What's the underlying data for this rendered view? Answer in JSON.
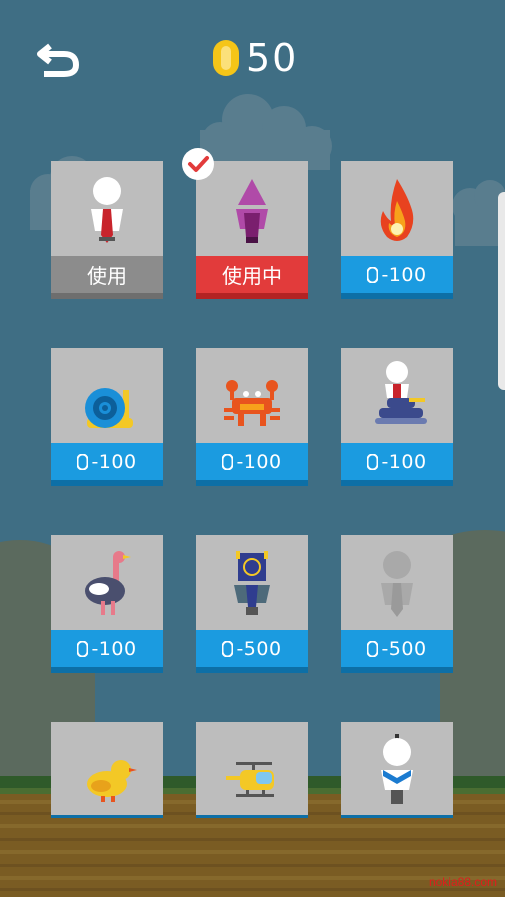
{
  "header": {
    "back_icon": "back-arrow-icon",
    "coin_icon": "coin-icon",
    "coin_count": "50"
  },
  "colors": {
    "sky": "#3f6e84",
    "card": "#bdbdbd",
    "use_bar": "#8c8c8c",
    "in_use_bar": "#e23b3b",
    "price_bar": "#1b9be0",
    "check": "#e23b3b"
  },
  "cards": [
    {
      "character": "stickman-white-red-tie",
      "status": "use",
      "label": "使用"
    },
    {
      "character": "wizard-purple",
      "status": "in-use",
      "label": "使用中",
      "selected": true
    },
    {
      "character": "fire",
      "status": "price",
      "label": "-100"
    },
    {
      "character": "snail",
      "status": "price",
      "label": "-100"
    },
    {
      "character": "crab",
      "status": "price",
      "label": "-100"
    },
    {
      "character": "tank-rider",
      "status": "price",
      "label": "-100"
    },
    {
      "character": "ostrich",
      "status": "price",
      "label": "-100"
    },
    {
      "character": "box-head-robot",
      "status": "price",
      "label": "-500"
    },
    {
      "character": "ghost-stickman",
      "status": "price",
      "label": "-500"
    },
    {
      "character": "duck",
      "status": "partial"
    },
    {
      "character": "helicopter",
      "status": "partial"
    },
    {
      "character": "stickman-blue-scarf",
      "status": "partial"
    }
  ],
  "selected_icon": "check-icon",
  "watermark": "nokia88.com"
}
